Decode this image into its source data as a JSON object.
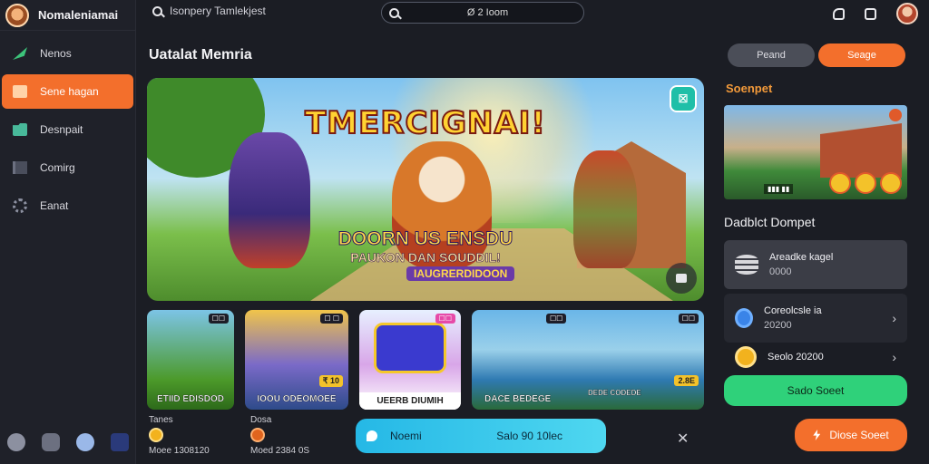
{
  "brand": {
    "name": "Nomaleniamai"
  },
  "sidebar": {
    "items": [
      {
        "label": "Nenos",
        "icon": "leaf-icon",
        "active": false
      },
      {
        "label": "Sene hagan",
        "icon": "document-icon",
        "active": true
      },
      {
        "label": "Desnpait",
        "icon": "folder-icon",
        "active": false
      },
      {
        "label": "Comirg",
        "icon": "book-icon",
        "active": false
      },
      {
        "label": "Eanat",
        "icon": "gear-icon",
        "active": false
      }
    ]
  },
  "header": {
    "search_left": "Isonpery Tamlekjest",
    "search_center": "Ø 2 Ioom"
  },
  "main": {
    "section_title": "Uatalat Memria",
    "hero": {
      "title": "TMERCIGNAI!",
      "subtitle1": "DOORN US ENSDU",
      "subtitle2": "PAUKON DAN SOUDDIL!",
      "subtitle3": "IAUGRERDIDOON",
      "badge": "☒"
    },
    "thumbs": [
      {
        "caption": "ETIID EDISDOD",
        "tag": "☐☐"
      },
      {
        "caption": "IOOU ODEOMOEE",
        "tag": "☐ ☐",
        "price": "₹ 10"
      },
      {
        "caption": "UEERB DIUMIH",
        "tag": "☐☐"
      },
      {
        "caption": "DACE BEDEGE",
        "caption2": "DEDE CODEDE",
        "tag": "☐☐",
        "tag2": "☐☐",
        "price": "2.8E"
      }
    ],
    "footer_items": [
      {
        "label": "Tanes",
        "value": "Moee 1308120"
      },
      {
        "label": "Dosa",
        "value": "Moed 2384 0S"
      }
    ],
    "promo": {
      "left": "Noemi",
      "right": "Salo 90 10lec"
    }
  },
  "right_panel": {
    "btn_ghost": "Peand",
    "btn_orange": "Seage",
    "title1": "Soenpet",
    "title2": "Dadblct Dompet",
    "wallet": [
      {
        "name": "Areadke kagel",
        "value": "0000"
      },
      {
        "name": "Coreolcsle ia",
        "value": "20200"
      },
      {
        "name": "Seolo 20200",
        "value": ""
      }
    ],
    "btn_green": "Sado Soeet",
    "btn_cta": "Diose Soeet"
  }
}
